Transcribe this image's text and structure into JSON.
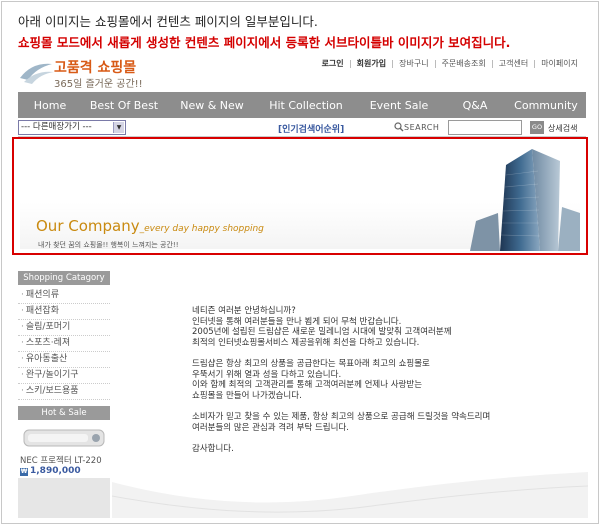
{
  "caption": {
    "line1": "아래 이미지는 쇼핑몰에서 컨텐츠 페이지의 일부분입니다.",
    "line2": "쇼핑몰 모드에서 새롭게 생성한 컨텐츠 페이지에서 등록한 서브타이틀바 이미지가 보여집니다."
  },
  "header": {
    "logo_title": "고품격 쇼핑몰",
    "logo_sub": "365일 즐거운 공간!!",
    "links": [
      "로그인",
      "회원가입",
      "장바구니",
      "주문배송조회",
      "고객센터",
      "마이페이지"
    ]
  },
  "nav": {
    "items": [
      "Home",
      "Best Of Best",
      "New & New",
      "Hit Collection",
      "Event Sale",
      "Q&A",
      "Community"
    ]
  },
  "search": {
    "shortcut_select": "--- 다른매장가기 ---",
    "popular_link": "[인기검색어순위]",
    "label": "SEARCH",
    "go": "GO",
    "advanced": "상세검색"
  },
  "banner": {
    "company": "Our Company",
    "tagline": "_every day happy shopping",
    "sub": "내가 찾던 꿈의 쇼핑몰!! 행복이 느껴지는 공간!!"
  },
  "sidebar": {
    "category_title": "Shopping Catagory",
    "categories": [
      "패션의류",
      "패션잡화",
      "슬림/포머기",
      "스포츠·레져",
      "유아동출산",
      "완구/놀이기구",
      "스키/보드용품"
    ],
    "hot_title": "Hot & Sale",
    "product_name": "NEC 프로젝터 LT-220",
    "product_price": "1,890,000",
    "won_symbol": "₩"
  },
  "content": {
    "p1": [
      "네티즌 여러분 안녕하십니까?",
      "인터넷을 통해 여러분들을 만나 뵙게 되어 무척 반갑습니다.",
      "2005년에 설립된 드림샵은 새로운 밀레니엄 시대에 발맞춰 고객여러분께",
      "최적의 인터넷쇼핑몰서비스 제공을위해 최선을 다하고 있습니다."
    ],
    "p2": [
      "드림샵은 항상 최고의 상품을 공급한다는 목표아래 최고의 쇼핑몰로",
      "우뚝서기 위해 열과 성을 다하고 있습니다.",
      "이와 함께 최적의 고객관리를 통해 고객여러분께 언제나 사랑받는",
      "쇼핑몰을 만들어 나가겠습니다."
    ],
    "p3": [
      "소비자가 믿고 찾을 수 있는 제품, 항상 최고의 상품으로 공급해 드릴것을 약속드리며",
      "여러분들의 많은 관심과 격려 부탁 드립니다."
    ],
    "p4": [
      "감사합니다."
    ]
  },
  "colors": {
    "nav_bg": "#8d8d8d",
    "banner_border": "#d80000",
    "logo_orange": "#d85a16",
    "company_gold": "#c98a10"
  }
}
